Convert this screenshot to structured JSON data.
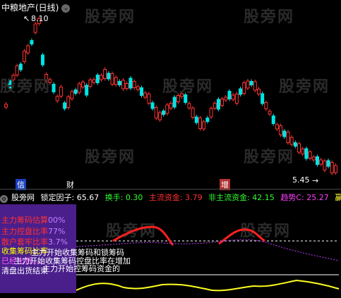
{
  "chart_title": {
    "name": "中粮地产(日线)"
  },
  "price_labels": {
    "high": "8.10",
    "low": "5.45"
  },
  "events": [
    {
      "label": "信",
      "color": "#ffffff"
    },
    {
      "label": "财",
      "color": "#ffffff"
    },
    {
      "label": "增",
      "color": "#ffffff"
    }
  ],
  "indicator_bar": {
    "name": "股旁网",
    "lock_factor": "锁定因子: 65.67",
    "turnover": "换手: 0.30",
    "main_capital": "主流资金: 3.79",
    "non_main_capital": "非主流资金: 42.15",
    "trend": "趋势C: 25.27",
    "extra": "赢和"
  },
  "legend": [
    {
      "text": "主力筹码估算",
      "suffix": "%",
      "color": "#ff3030"
    },
    {
      "text": "主力控盘比率",
      "suffix": "%",
      "color": "#ff3030"
    },
    {
      "text": "散户套牢比率",
      "suffix": "%",
      "color": "#ff3030"
    },
    {
      "text": "收集筹码比率",
      "suffix": "",
      "color": "#ffff00"
    },
    {
      "text": "已经出货。。。",
      "suffix": "",
      "color": "#ff60ff"
    },
    {
      "text": "清盘出货结束",
      "suffix": "",
      "color": "#ffffff"
    }
  ],
  "overlay_texts": [
    {
      "text": "主力开始收集筹码和锁筹码",
      "color": "#ffffff"
    },
    {
      "text": "主力开始收集筹码控盘比率在增加",
      "color": "#ffffff"
    },
    {
      "text": "主力开始控筹码资金的",
      "color": "#ffffff"
    }
  ],
  "watermark": "股旁网",
  "colors": {
    "up": "#ff3333",
    "down": "#00e5e5",
    "red_line": "#ff2020",
    "magenta": "#c040ff",
    "yellow": "#ffff20"
  }
}
